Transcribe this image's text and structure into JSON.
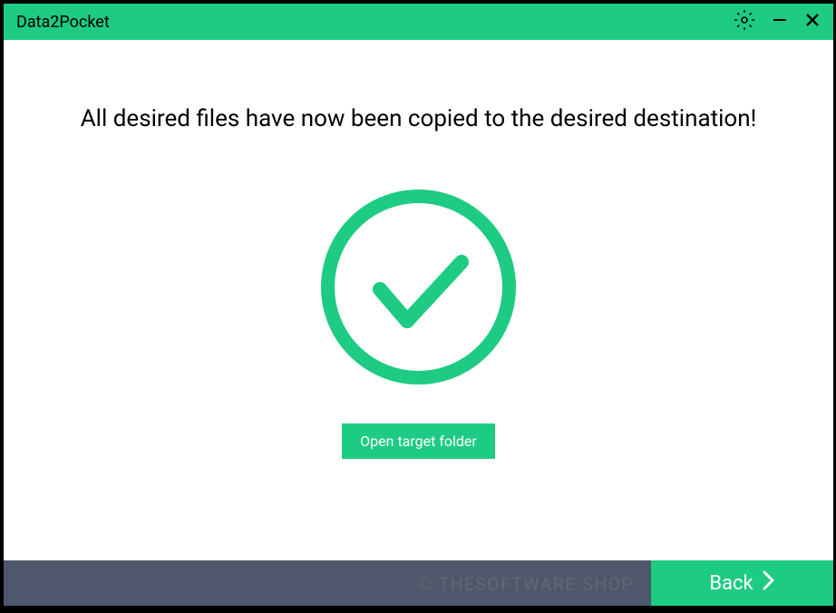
{
  "titlebar": {
    "title": "Data2Pocket"
  },
  "content": {
    "message": "All desired files have now been copied to the desired destination!",
    "open_folder_label": "Open target folder"
  },
  "footer": {
    "back_label": "Back"
  },
  "watermark": "© THESOFTWARE.SHOP",
  "colors": {
    "accent": "#1ECB83",
    "footer_bg": "#4E576B"
  }
}
